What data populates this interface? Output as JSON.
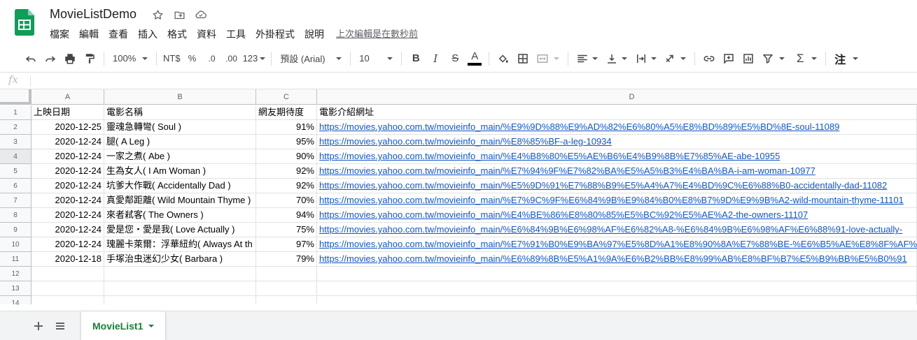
{
  "app": {
    "title": "MovieListDemo"
  },
  "menu": {
    "items": [
      "檔案",
      "編輯",
      "查看",
      "插入",
      "格式",
      "資料",
      "工具",
      "外掛程式",
      "說明"
    ],
    "last_edit": "上次編輯是在數秒前"
  },
  "toolbar": {
    "zoom": "100%",
    "currency": "NT$",
    "percent": "%",
    "dec_decrease": ".0",
    "dec_increase": ".00",
    "more_formats": "123",
    "font": "預設 (Arial)",
    "font_size": "10",
    "bold": "B",
    "italic": "I",
    "strike": "S",
    "text_color": "A",
    "input_tools": "注"
  },
  "formula": {
    "fx": "fx",
    "value": ""
  },
  "grid": {
    "columns": [
      "A",
      "B",
      "C",
      "D"
    ],
    "row_numbers": [
      "1",
      "2",
      "3",
      "4",
      "5",
      "6",
      "7",
      "8",
      "9",
      "10",
      "11",
      "12",
      "13",
      "14"
    ],
    "rows": [
      [
        "上映日期",
        "電影名稱",
        "網友期待度",
        "電影介紹網址"
      ],
      [
        "2020-12-25",
        "靈魂急轉彎( Soul )",
        "91%",
        "https://movies.yahoo.com.tw/movieinfo_main/%E9%9D%88%E9%AD%82%E6%80%A5%E8%BD%89%E5%BD%8E-soul-11089"
      ],
      [
        "2020-12-24",
        "腿( A Leg )",
        "95%",
        "https://movies.yahoo.com.tw/movieinfo_main/%E8%85%BF-a-leg-10934"
      ],
      [
        "2020-12-24",
        "一家之煮( Abe )",
        "90%",
        "https://movies.yahoo.com.tw/movieinfo_main/%E4%B8%80%E5%AE%B6%E4%B9%8B%E7%85%AE-abe-10955"
      ],
      [
        "2020-12-24",
        "生為女人( I Am Woman )",
        "92%",
        "https://movies.yahoo.com.tw/movieinfo_main/%E7%94%9F%E7%82%BA%E5%A5%B3%E4%BA%BA-i-am-woman-10977"
      ],
      [
        "2020-12-24",
        "坑爹大作戰( Accidentally Dad )",
        "92%",
        "https://movies.yahoo.com.tw/movieinfo_main/%E5%9D%91%E7%88%B9%E5%A4%A7%E4%BD%9C%E6%88%B0-accidentally-dad-11082"
      ],
      [
        "2020-12-24",
        "真愛鄰距離( Wild Mountain Thyme )",
        "70%",
        "https://movies.yahoo.com.tw/movieinfo_main/%E7%9C%9F%E6%84%9B%E9%84%B0%E8%B7%9D%E9%9B%A2-wild-mountain-thyme-11101"
      ],
      [
        "2020-12-24",
        "來者弒客( The Owners )",
        "94%",
        "https://movies.yahoo.com.tw/movieinfo_main/%E4%BE%86%E8%80%85%E5%BC%92%E5%AE%A2-the-owners-11107"
      ],
      [
        "2020-12-24",
        "愛是您・愛是我( Love Actually )",
        "75%",
        "https://movies.yahoo.com.tw/movieinfo_main/%E6%84%9B%E6%98%AF%E6%82%A8-%E6%84%9B%E6%98%AF%E6%88%91-love-actually-"
      ],
      [
        "2020-12-24",
        "瑰麗卡萊爾：浮華紐約( Always At th",
        "97%",
        "https://movies.yahoo.com.tw/movieinfo_main/%E7%91%B0%E9%BA%97%E5%8D%A1%E8%90%8A%E7%88%BE-%E6%B5%AE%E8%8F%AF%E7"
      ],
      [
        "2020-12-18",
        "手塚治虫迷幻少女( Barbara )",
        "79%",
        "https://movies.yahoo.com.tw/movieinfo_main/%E6%89%8B%E5%A1%9A%E6%B2%BB%E8%99%AB%E8%BF%B7%E5%B9%BB%E5%B0%91"
      ],
      [
        "",
        "",
        "",
        ""
      ],
      [
        "",
        "",
        "",
        ""
      ],
      [
        "",
        "",
        "",
        ""
      ]
    ]
  },
  "sheets": {
    "active": "MovieList1"
  },
  "colors": {
    "link": "#1155cc",
    "tab_green": "#188038",
    "logo_green": "#0f9d58"
  }
}
